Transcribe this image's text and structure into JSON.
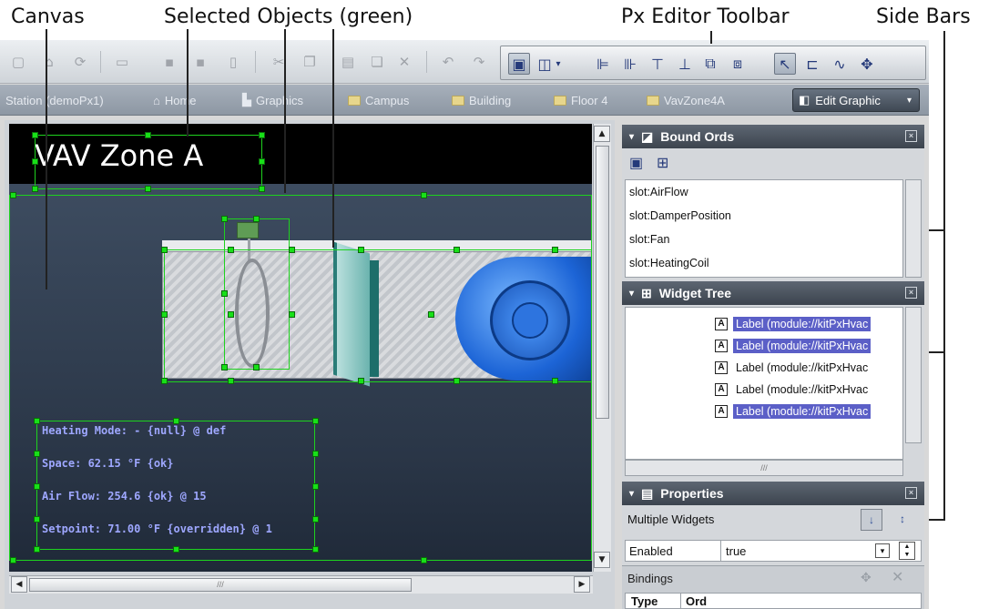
{
  "callouts": {
    "canvas": "Canvas",
    "selected_objects": "Selected Objects (green)",
    "px_editor_toolbar": "Px Editor Toolbar",
    "side_bars": "Side Bars"
  },
  "nav": {
    "crumbs": [
      "Station (demoPx1)",
      "Home",
      "Graphics",
      "Campus",
      "Building",
      "Floor 4",
      "VavZone4A"
    ],
    "mode_button": "Edit Graphic"
  },
  "canvas": {
    "title": "VAV Zone A",
    "labels": [
      "Heating Mode: - {null} @ def",
      "Space: 62.15 °F {ok}",
      "Air Flow: 254.6 {ok} @ 15",
      "Setpoint: 71.00 °F {overridden} @ 1"
    ],
    "hscroll_grip": "///"
  },
  "bound_ords": {
    "title": "Bound Ords",
    "items": [
      "slot:AirFlow",
      "slot:DamperPosition",
      "slot:Fan",
      "slot:HeatingCoil"
    ]
  },
  "widget_tree": {
    "title": "Widget Tree",
    "items": [
      {
        "label": "Label (module://kitPxHvac",
        "selected": true
      },
      {
        "label": "Label (module://kitPxHvac",
        "selected": true
      },
      {
        "label": "Label (module://kitPxHvac",
        "selected": false
      },
      {
        "label": "Label (module://kitPxHvac",
        "selected": false
      },
      {
        "label": "Label (module://kitPxHvac",
        "selected": true
      }
    ],
    "hscroll_grip": "///"
  },
  "properties": {
    "title": "Properties",
    "subject": "Multiple Widgets",
    "rows": [
      {
        "name": "Enabled",
        "value": "true"
      }
    ]
  },
  "bindings": {
    "title": "Bindings",
    "columns": [
      "Type",
      "Ord"
    ]
  },
  "colors": {
    "selection": "#1ed21e",
    "canvas_bg": "#2c3a4c",
    "tree_selection": "#5b5fc7"
  }
}
